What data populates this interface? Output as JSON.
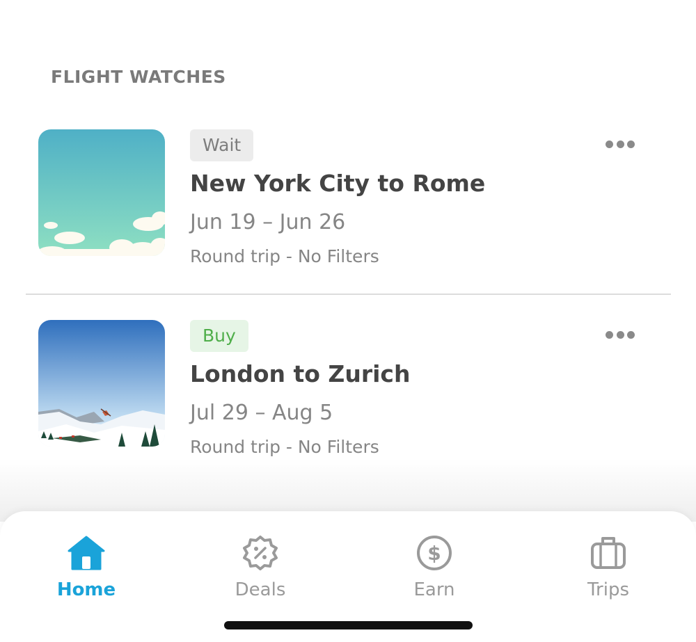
{
  "section": {
    "title": "FLIGHT WATCHES"
  },
  "watches": [
    {
      "badge": "Wait",
      "route": "New York City to Rome",
      "dates": "Jun 19 – Jun 26",
      "meta": "Round trip - No Filters",
      "image": "sky-clouds-illustration"
    },
    {
      "badge": "Buy",
      "route": "London to Zurich",
      "dates": "Jul 29 – Aug 5",
      "meta": "Round trip - No Filters",
      "image": "snowy-mountains-illustration"
    }
  ],
  "tabs": [
    {
      "label": "Home",
      "icon": "home-icon",
      "active": true
    },
    {
      "label": "Deals",
      "icon": "deals-badge-icon",
      "active": false
    },
    {
      "label": "Earn",
      "icon": "dollar-coin-icon",
      "active": false
    },
    {
      "label": "Trips",
      "icon": "suitcase-icon",
      "active": false
    }
  ],
  "colors": {
    "accent": "#1aa3d9",
    "wait_badge_bg": "#ececec",
    "buy_badge_bg": "#e6f5e6",
    "buy_text": "#4fae4a"
  }
}
